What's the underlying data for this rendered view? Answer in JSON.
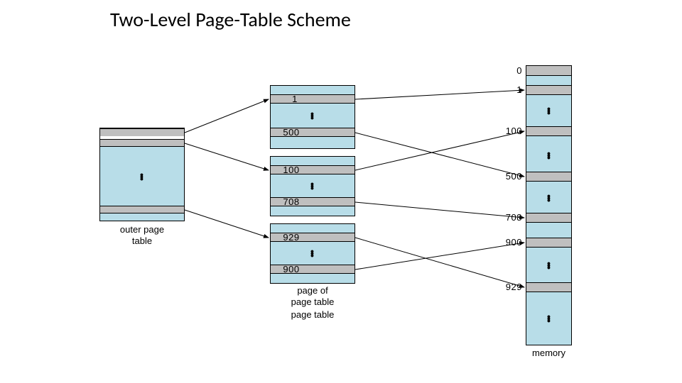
{
  "title": "Two-Level Page-Table Scheme",
  "outer_page_table": {
    "caption": "outer page\ntable"
  },
  "page_of_page_table": {
    "caption": "page of\npage table",
    "caption2": "page table",
    "entries": {
      "a1": "1",
      "a2": "500",
      "b1": "100",
      "b2": "708",
      "c1": "929",
      "c2": "900"
    }
  },
  "memory": {
    "caption": "memory",
    "labels": {
      "l0": "0",
      "l1": "1",
      "l100": "100",
      "l500": "500",
      "l708": "708",
      "l900": "900",
      "l929": "929"
    }
  }
}
